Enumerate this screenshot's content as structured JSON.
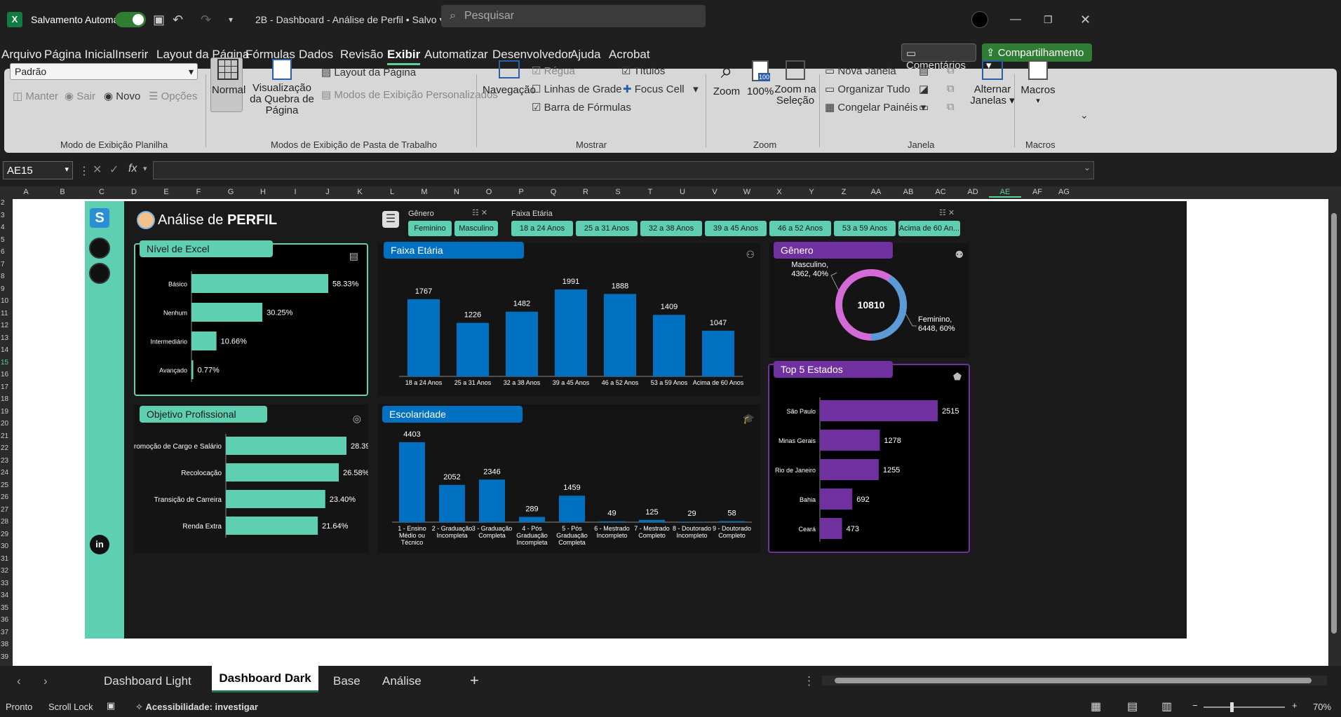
{
  "titlebar": {
    "autosave": "Salvamento Automático",
    "doc_title": "2B - Dashboard - Análise de Perfil • Salvo",
    "search_placeholder": "Pesquisar"
  },
  "menu": [
    "Arquivo",
    "Página Inicial",
    "Inserir",
    "Layout da Página",
    "Fórmulas",
    "Dados",
    "Revisão",
    "Exibir",
    "Automatizar",
    "Desenvolvedor",
    "Ajuda",
    "Acrobat"
  ],
  "menu_active": "Exibir",
  "menu_right": {
    "comments": "Comentários",
    "share": "Compartilhamento"
  },
  "ribbon": {
    "view_select": "Padrão",
    "manter": "Manter",
    "sair": "Sair",
    "novo": "Novo",
    "opcoes": "Opções",
    "group1": "Modo de Exibição Planilha",
    "normal": "Normal",
    "page_break": "Visualização da Quebra de Página",
    "page_layout": "Layout da Página",
    "custom_views": "Modos de Exibição Personalizados",
    "group2": "Modos de Exibição de Pasta de Trabalho",
    "navegacao": "Navegação",
    "regua": "Régua",
    "linhas": "Linhas de Grade",
    "barra": "Barra de Fórmulas",
    "titulos": "Títulos",
    "focus": "Focus Cell",
    "group3": "Mostrar",
    "zoom": "Zoom",
    "zoom100": "100%",
    "zoom_sel": "Zoom na Seleção",
    "group4": "Zoom",
    "nova_janela": "Nova Janela",
    "organizar": "Organizar Tudo",
    "congelar": "Congelar Painéis",
    "alternar": "Alternar Janelas",
    "group5": "Janela",
    "macros": "Macros",
    "group6": "Macros"
  },
  "formula": {
    "namebox": "AE15",
    "fx": "fx"
  },
  "columns": [
    "A",
    "B",
    "C",
    "D",
    "E",
    "F",
    "G",
    "H",
    "I",
    "J",
    "K",
    "L",
    "M",
    "N",
    "O",
    "P",
    "Q",
    "R",
    "S",
    "T",
    "U",
    "V",
    "W",
    "X",
    "Y",
    "Z",
    "AA",
    "AB",
    "AC",
    "AD",
    "AE",
    "AF",
    "AG"
  ],
  "rows": [
    "2",
    "3",
    "4",
    "5",
    "6",
    "7",
    "8",
    "9",
    "10",
    "11",
    "12",
    "13",
    "14",
    "15",
    "16",
    "17",
    "18",
    "19",
    "20",
    "21",
    "22",
    "23",
    "24",
    "25",
    "26",
    "27",
    "28",
    "29",
    "30",
    "31",
    "32",
    "33",
    "34",
    "35",
    "36",
    "37",
    "38",
    "39"
  ],
  "dashboard": {
    "title_a": "Análise de ",
    "title_b": "PERFIL",
    "filter_genero": "Gênero",
    "filter_faixa": "Faixa Etária",
    "genero_chips": [
      "Feminino",
      "Masculino"
    ],
    "faixa_chips": [
      "18 a 24 Anos",
      "25 a 31 Anos",
      "32 a 38 Anos",
      "39 a 45 Anos",
      "46 a 52 Anos",
      "53 a 59 Anos",
      "Acima de 60 An..."
    ],
    "nivel": {
      "title": "Nível de Excel",
      "items": [
        {
          "label": "Básico",
          "value": 58.33,
          "text": "58.33%"
        },
        {
          "label": "Nenhum",
          "value": 30.25,
          "text": "30.25%"
        },
        {
          "label": "Intermediário",
          "value": 10.66,
          "text": "10.66%"
        },
        {
          "label": "Avançado",
          "value": 0.77,
          "text": "0.77%"
        }
      ]
    },
    "faixa": {
      "title": "Faixa Etária",
      "categories": [
        "18 a 24 Anos",
        "25 a 31 Anos",
        "32 a 38 Anos",
        "39 a 45 Anos",
        "46 a 52 Anos",
        "53 a 59 Anos",
        "Acima de 60 Anos"
      ],
      "values": [
        1767,
        1226,
        1482,
        1991,
        1888,
        1409,
        1047
      ]
    },
    "genero": {
      "title": "Gênero",
      "total": "10810",
      "masc": "Masculino, 4362, 40%",
      "fem": "Feminino, 6448, 60%",
      "fem_value": 6448,
      "masc_value": 4362
    },
    "objetivo": {
      "title": "Objetivo Profissional",
      "items": [
        {
          "label": "Promoção de Cargo e Salário",
          "value": 28.39,
          "text": "28.39%"
        },
        {
          "label": "Recolocação",
          "value": 26.58,
          "text": "26.58%"
        },
        {
          "label": "Transição de Carreira",
          "value": 23.4,
          "text": "23.40%"
        },
        {
          "label": "Renda Extra",
          "value": 21.64,
          "text": "21.64%"
        }
      ]
    },
    "escolaridade": {
      "title": "Escolaridade",
      "categories": [
        "1 - Ensino Médio ou Técnico",
        "2 - Graduação Incompleta",
        "3 - Graduação Completa",
        "4 - Pós Graduação Incompleta",
        "5 - Pós Graduação Completa",
        "6 - Mestrado Incompleto",
        "7 - Mestrado Completo",
        "8 - Doutorado Incompleto",
        "9 - Doutorado Completo"
      ],
      "values": [
        4403,
        2052,
        2346,
        289,
        1459,
        49,
        125,
        29,
        58
      ]
    },
    "estados": {
      "title": "Top 5 Estados",
      "items": [
        {
          "label": "São Paulo",
          "value": 2515
        },
        {
          "label": "Minas Gerais",
          "value": 1278
        },
        {
          "label": "Rio de Janeiro",
          "value": 1255
        },
        {
          "label": "Bahia",
          "value": 692
        },
        {
          "label": "Ceará",
          "value": 473
        }
      ]
    }
  },
  "chart_data": [
    {
      "type": "bar",
      "title": "Nível de Excel",
      "categories": [
        "Básico",
        "Nenhum",
        "Intermediário",
        "Avançado"
      ],
      "values": [
        58.33,
        30.25,
        10.66,
        0.77
      ]
    },
    {
      "type": "bar",
      "title": "Faixa Etária",
      "categories": [
        "18 a 24 Anos",
        "25 a 31 Anos",
        "32 a 38 Anos",
        "39 a 45 Anos",
        "46 a 52 Anos",
        "53 a 59 Anos",
        "Acima de 60 Anos"
      ],
      "values": [
        1767,
        1226,
        1482,
        1991,
        1888,
        1409,
        1047
      ]
    },
    {
      "type": "pie",
      "title": "Gênero",
      "categories": [
        "Masculino",
        "Feminino"
      ],
      "values": [
        4362,
        6448
      ]
    },
    {
      "type": "bar",
      "title": "Objetivo Profissional",
      "categories": [
        "Promoção de Cargo e Salário",
        "Recolocação",
        "Transição de Carreira",
        "Renda Extra"
      ],
      "values": [
        28.39,
        26.58,
        23.4,
        21.64
      ]
    },
    {
      "type": "bar",
      "title": "Escolaridade",
      "categories": [
        "1 - Ensino Médio ou Técnico",
        "2 - Graduação Incompleta",
        "3 - Graduação Completa",
        "4 - Pós Graduação Incompleta",
        "5 - Pós Graduação Completa",
        "6 - Mestrado Incompleto",
        "7 - Mestrado Completo",
        "8 - Doutorado Incompleto",
        "9 - Doutorado Completo"
      ],
      "values": [
        4403,
        2052,
        2346,
        289,
        1459,
        49,
        125,
        29,
        58
      ]
    },
    {
      "type": "bar",
      "title": "Top 5 Estados",
      "categories": [
        "São Paulo",
        "Minas Gerais",
        "Rio de Janeiro",
        "Bahia",
        "Ceará"
      ],
      "values": [
        2515,
        1278,
        1255,
        692,
        473
      ]
    }
  ],
  "tabs": [
    "Dashboard Light",
    "Dashboard Dark",
    "Base",
    "Análise"
  ],
  "active_tab": "Dashboard Dark",
  "status": {
    "ready": "Pronto",
    "scroll": "Scroll Lock",
    "access": "Acessibilidade: investigar",
    "zoom": "70%"
  },
  "colors": {
    "teal": "#5ecfb1",
    "blue": "#0070c0",
    "purple": "#7030a0",
    "pink": "#d36ad6",
    "lightblue": "#5b9bd5",
    "green": "#2e7d32"
  }
}
